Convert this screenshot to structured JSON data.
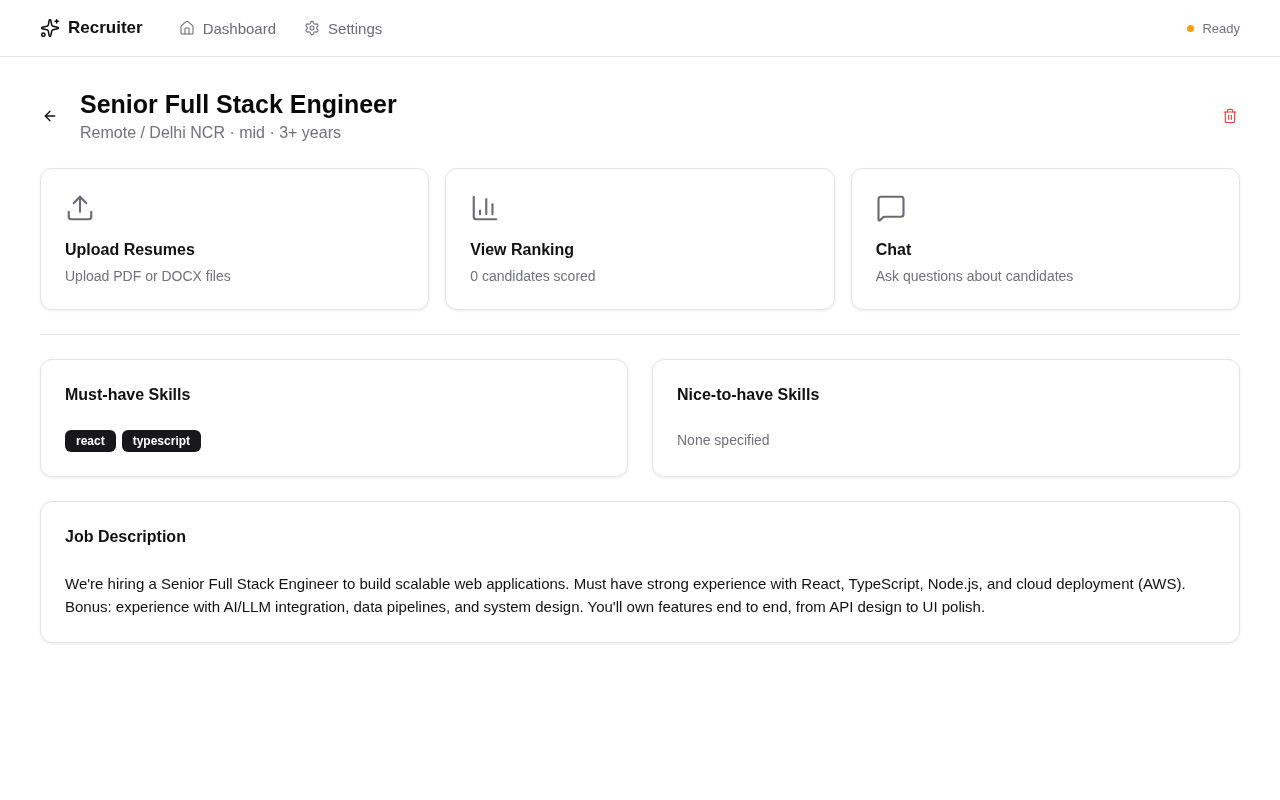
{
  "header": {
    "brand": "Recruiter",
    "nav": [
      {
        "label": "Dashboard",
        "kind": "home",
        "selected": false
      },
      {
        "label": "Settings",
        "kind": "settings",
        "selected": false
      }
    ],
    "status": {
      "label": "Ready",
      "color": "#f59e0b"
    }
  },
  "job": {
    "title": "Senior Full Stack Engineer",
    "meta": "Remote / Delhi NCR · mid · 3+ years"
  },
  "actions": [
    {
      "kind": "upload",
      "title": "Upload Resumes",
      "subtitle": "Upload PDF or DOCX files"
    },
    {
      "kind": "ranking",
      "title": "View Ranking",
      "subtitle": "0 candidates scored"
    },
    {
      "kind": "chat",
      "title": "Chat",
      "subtitle": "Ask questions about candidates"
    }
  ],
  "skill_panels": [
    {
      "title": "Must-have Skills",
      "tags": [
        "react",
        "typescript"
      ]
    },
    {
      "title": "Nice-to-have Skills",
      "empty_note": "None specified"
    }
  ],
  "description": {
    "title": "Job Description",
    "text": "We're hiring a Senior Full Stack Engineer to build scalable web applications. Must have strong experience with React, TypeScript, Node.js, and cloud deployment (AWS). Bonus: experience with AI/LLM integration, data pipelines, and system design. You'll own features end to end, from API design to UI polish."
  }
}
